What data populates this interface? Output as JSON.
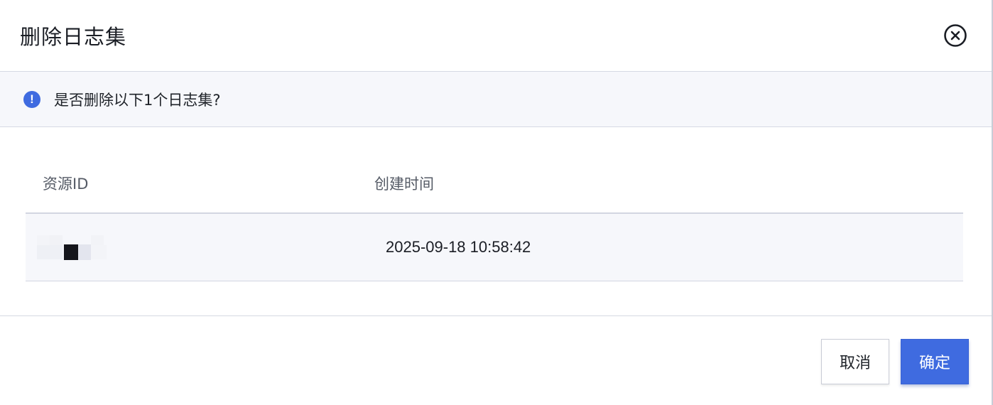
{
  "dialog": {
    "title": "删除日志集",
    "close_icon": "close-circle-icon"
  },
  "alert": {
    "icon": "exclamation-circle-icon",
    "color": "#3f6be0",
    "text": "是否删除以下1个日志集?"
  },
  "table": {
    "columns": [
      "资源ID",
      "创建时间"
    ],
    "rows": [
      {
        "resource_id": "",
        "created_at": "2025-09-18 10:58:42"
      }
    ]
  },
  "footer": {
    "cancel_label": "取消",
    "confirm_label": "确定",
    "accent_color": "#3f6be0"
  }
}
